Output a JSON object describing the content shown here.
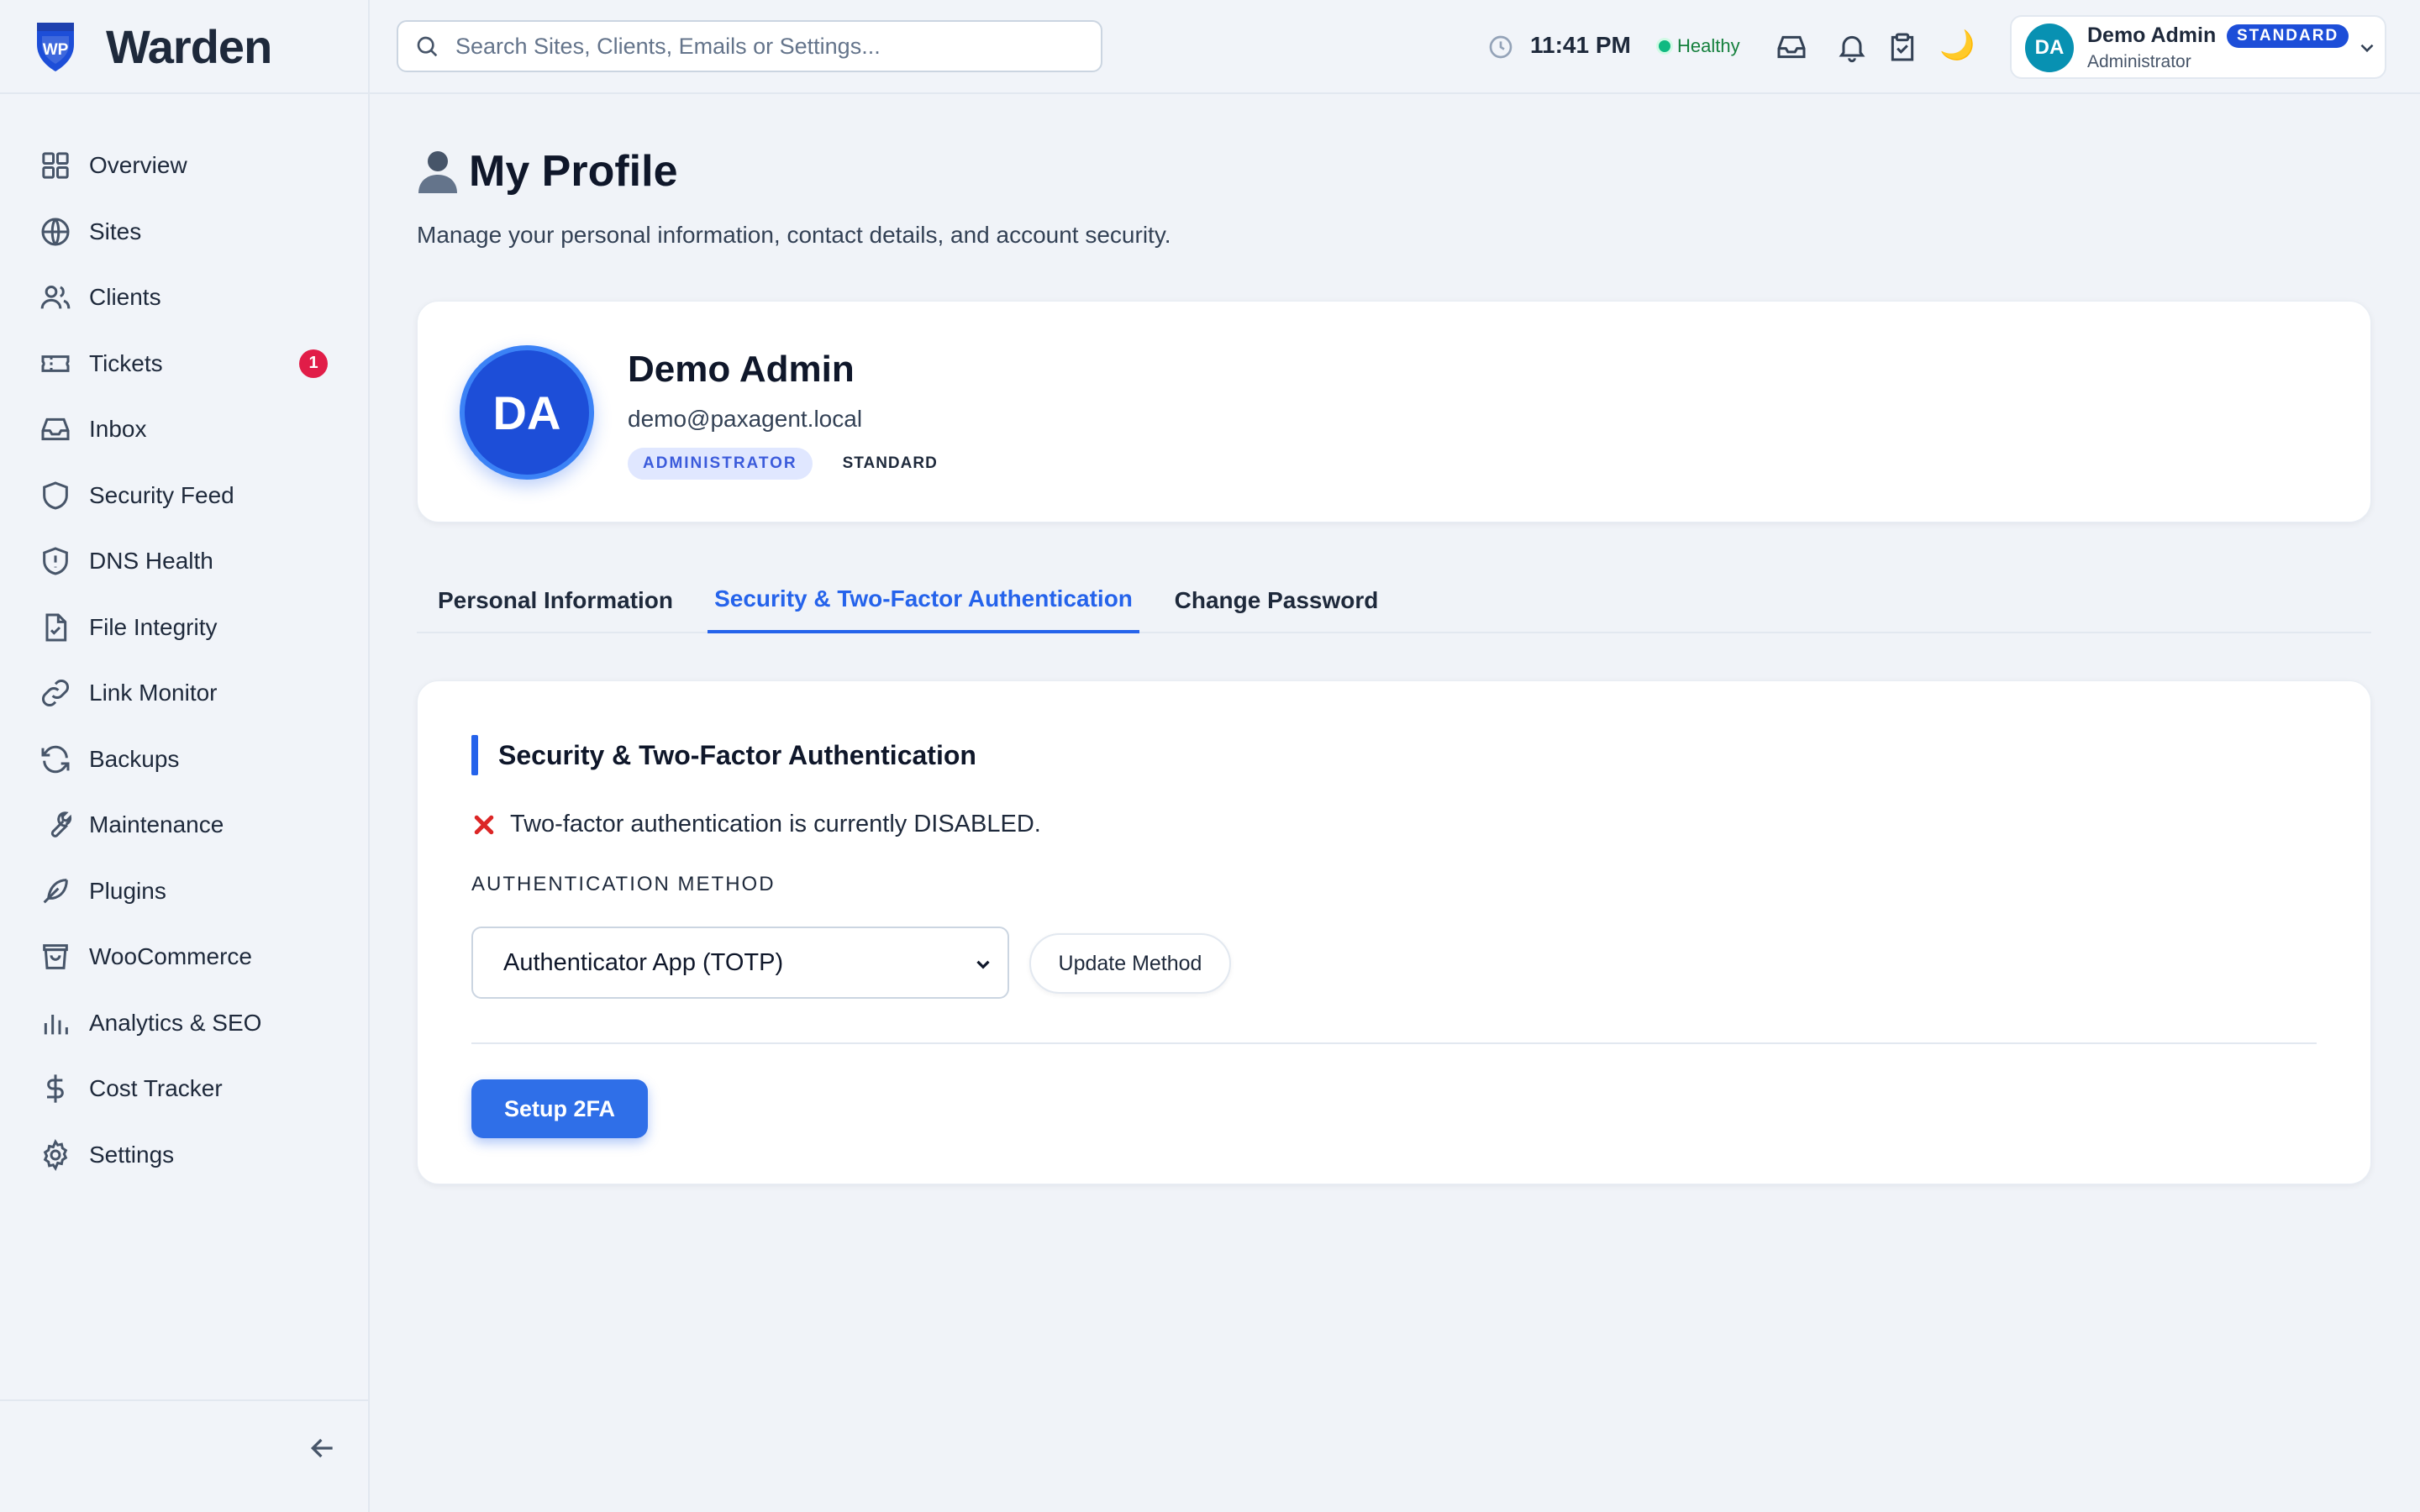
{
  "brand": {
    "name": "Warden",
    "logo_text": "WP"
  },
  "sidebar": {
    "items": [
      {
        "label": "Overview",
        "icon": "grid-icon"
      },
      {
        "label": "Sites",
        "icon": "globe-icon"
      },
      {
        "label": "Clients",
        "icon": "users-icon"
      },
      {
        "label": "Tickets",
        "icon": "ticket-icon",
        "badge": "1"
      },
      {
        "label": "Inbox",
        "icon": "inbox-icon"
      },
      {
        "label": "Security Feed",
        "icon": "shield-icon"
      },
      {
        "label": "DNS Health",
        "icon": "shield-alert-icon"
      },
      {
        "label": "File Integrity",
        "icon": "file-check-icon"
      },
      {
        "label": "Link Monitor",
        "icon": "link-icon"
      },
      {
        "label": "Backups",
        "icon": "refresh-icon"
      },
      {
        "label": "Maintenance",
        "icon": "wrench-icon"
      },
      {
        "label": "Plugins",
        "icon": "feather-icon"
      },
      {
        "label": "WooCommerce",
        "icon": "shopping-bag-icon"
      },
      {
        "label": "Analytics & SEO",
        "icon": "bar-chart-icon"
      },
      {
        "label": "Cost Tracker",
        "icon": "dollar-icon"
      },
      {
        "label": "Settings",
        "icon": "gear-icon"
      }
    ]
  },
  "topbar": {
    "search_placeholder": "Search Sites, Clients, Emails or Settings...",
    "time": "11:41 PM",
    "health": "Healthy",
    "user": {
      "initials": "DA",
      "name": "Demo Admin",
      "role": "Administrator",
      "plan": "STANDARD"
    }
  },
  "page": {
    "title": "My Profile",
    "subtitle": "Manage your personal information, contact details, and account security."
  },
  "profile": {
    "initials": "DA",
    "name": "Demo Admin",
    "email": "demo@paxagent.local",
    "role_badge": "ADMINISTRATOR",
    "plan_badge": "STANDARD"
  },
  "tabs": [
    {
      "label": "Personal Information",
      "active": false
    },
    {
      "label": "Security & Two-Factor Authentication",
      "active": true
    },
    {
      "label": "Change Password",
      "active": false
    }
  ],
  "security": {
    "title": "Security & Two-Factor Authentication",
    "status": "Two-factor authentication is currently DISABLED.",
    "method_label": "AUTHENTICATION METHOD",
    "method_value": "Authenticator App (TOTP)",
    "update_button": "Update Method",
    "setup_button": "Setup 2FA"
  },
  "colors": {
    "accent": "#2563eb",
    "danger": "#dc2626",
    "healthy": "#10b981",
    "badge": "#e11d48"
  }
}
